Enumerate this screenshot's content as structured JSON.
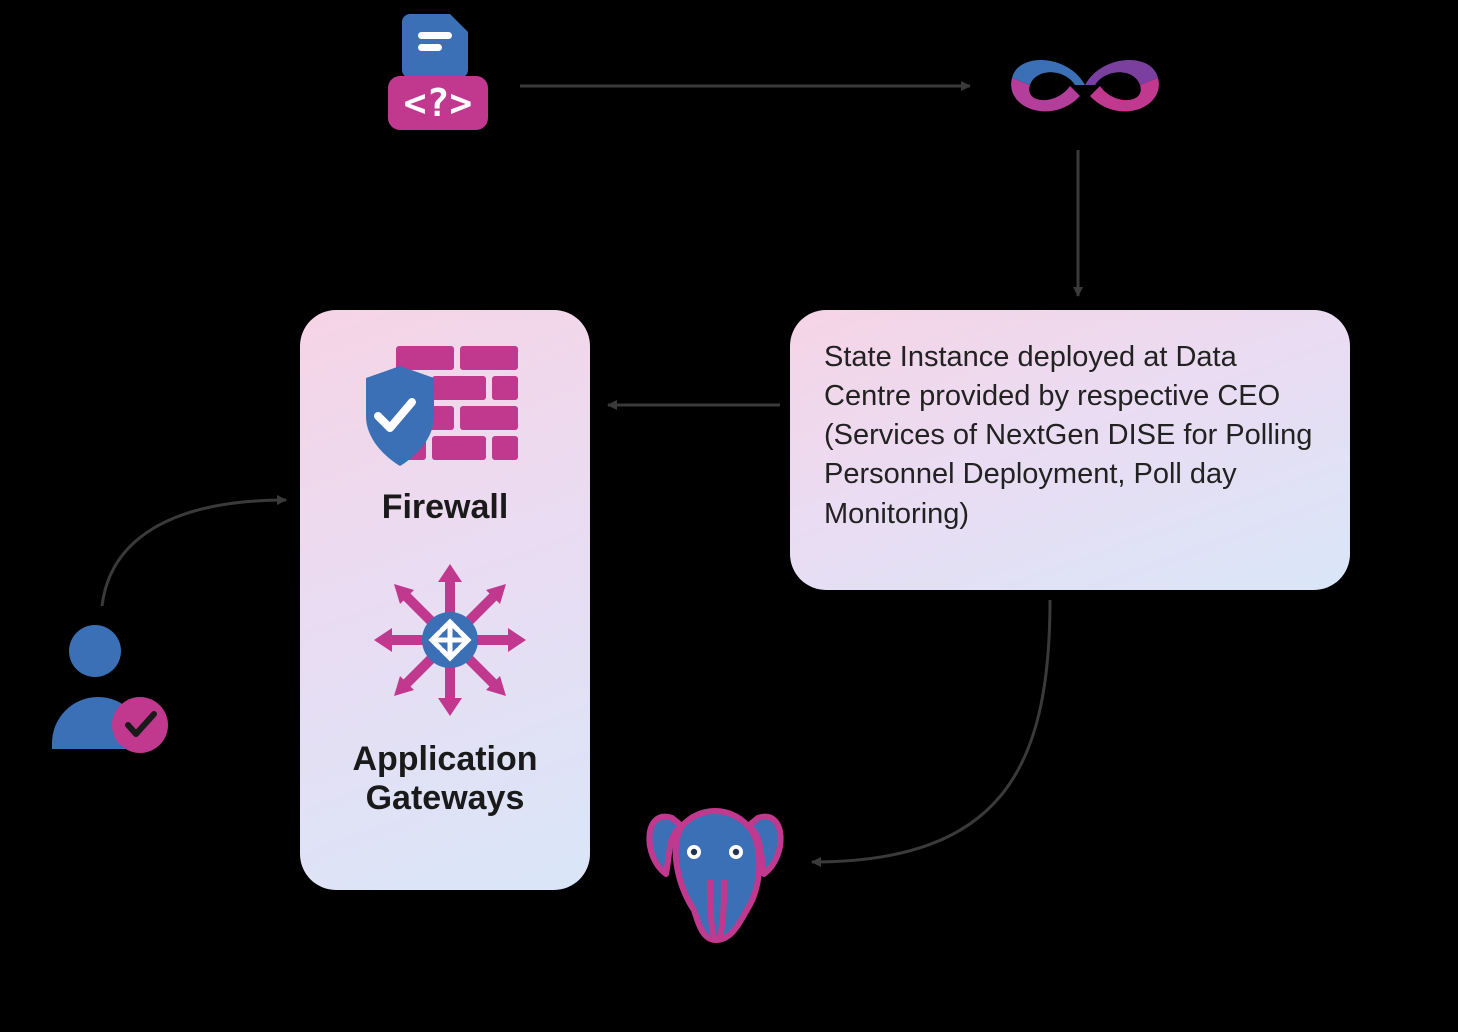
{
  "nodes": {
    "code": {
      "name": "code-icon"
    },
    "devops": {
      "name": "devops-infinity-icon"
    },
    "state_instance": {
      "text": "State Instance deployed at Data Centre provided by respective CEO (Services of NextGen DISE for Polling Personnel Deployment, Poll day Monitoring)"
    },
    "security_box": {
      "firewall_label": "Firewall",
      "gateways_label": "Application Gateways"
    },
    "user": {
      "name": "user-verified-icon"
    },
    "postgres": {
      "name": "postgresql-elephant-icon"
    }
  },
  "colors": {
    "blue": "#3b6fb6",
    "magenta": "#c0398f",
    "purple": "#7b3fa0",
    "arrow": "#3a3a3a",
    "box_grad_a": "#f6d4e6",
    "box_grad_b": "#d9e6f8"
  }
}
